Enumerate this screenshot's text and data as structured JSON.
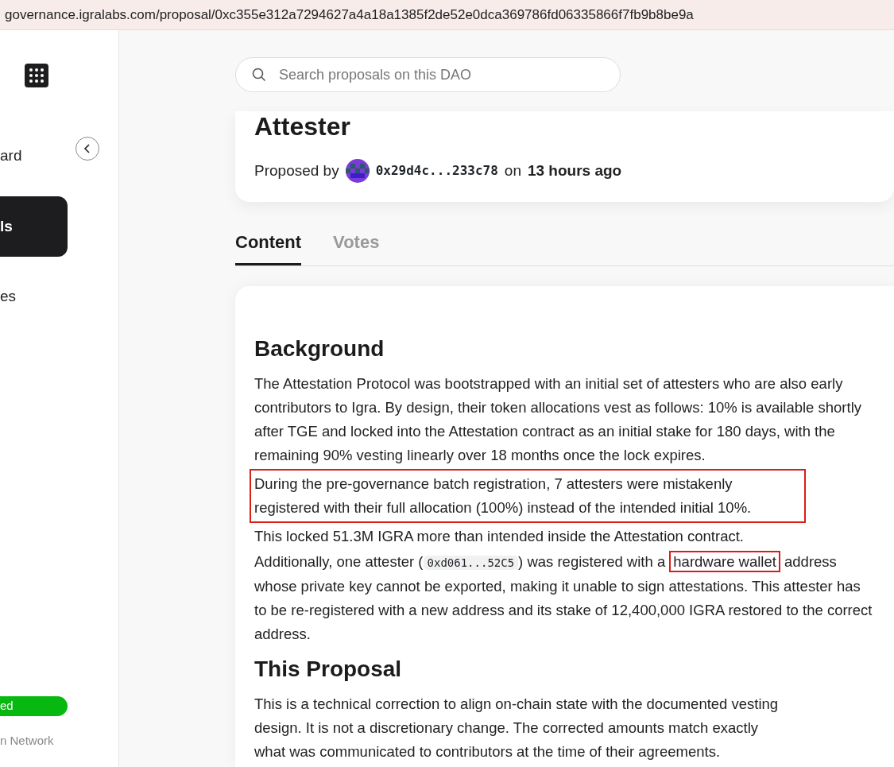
{
  "address_bar": {
    "url": "governance.igralabs.com/proposal/0xc355e312a7294627a4a18a1385f2de52e0dca369786fd06335866f7fb9b8be9a"
  },
  "sidebar": {
    "items": [
      {
        "label": "ard",
        "selected": false
      },
      {
        "label": "ls",
        "selected": true
      },
      {
        "label": "es",
        "selected": false
      }
    ],
    "status_badge": "ed",
    "network": "n Network"
  },
  "search": {
    "placeholder": "Search proposals on this DAO"
  },
  "proposal": {
    "title": "Attester",
    "proposed_by_label": "Proposed by",
    "proposer": "0x29d4c...233c78",
    "on_label": "on",
    "time": "13 hours ago"
  },
  "tabs": [
    {
      "label": "Content",
      "selected": true
    },
    {
      "label": "Votes",
      "selected": false
    }
  ],
  "sections": [
    {
      "heading": "Background",
      "paragraphs": [
        [
          {
            "kind": "text",
            "text": "The Attestation Protocol was bootstrapped with an initial set of attesters who are also early contributors to Igra. By design, their token allocations vest as follows: 10% is available shortly after TGE and locked into the Attestation contract as an initial stake for 180 days, with the remaining 90% vesting linearly over 18 months once the lock expires.",
            "highlighted": false
          }
        ],
        [
          {
            "kind": "text",
            "text": "During the pre-governance batch registration, 7 attesters were mistakenly registered with their full allocation (100%) instead of the intended initial 10%.",
            "highlighted": true
          }
        ],
        [
          {
            "kind": "text",
            "text": "This locked 51.3M IGRA more than intended inside the Attestation contract.",
            "highlighted": false
          }
        ],
        [
          {
            "kind": "text",
            "text": "Additionally, one attester (",
            "highlighted": false
          },
          {
            "kind": "code",
            "text": "0xd061...52C5",
            "highlighted": false
          },
          {
            "kind": "text",
            "text": ") was registered with a ",
            "highlighted": false
          },
          {
            "kind": "text",
            "text": "hardware wallet",
            "highlighted": true
          },
          {
            "kind": "text",
            "text": " address whose private key cannot be exported, making it unable to sign attestations. This attester has to be re-registered with a new address and its stake of 12,400,000 IGRA restored to the correct address.",
            "highlighted": false
          }
        ]
      ]
    },
    {
      "heading": "This Proposal",
      "paragraphs": [
        [
          {
            "kind": "text",
            "text": "This is a technical correction to align on-chain state with the documented vesting design. It is not a discretionary change. The corrected amounts match exactly what was communicated to contributors at the time of their agreements.",
            "highlighted": false
          }
        ]
      ]
    }
  ]
}
